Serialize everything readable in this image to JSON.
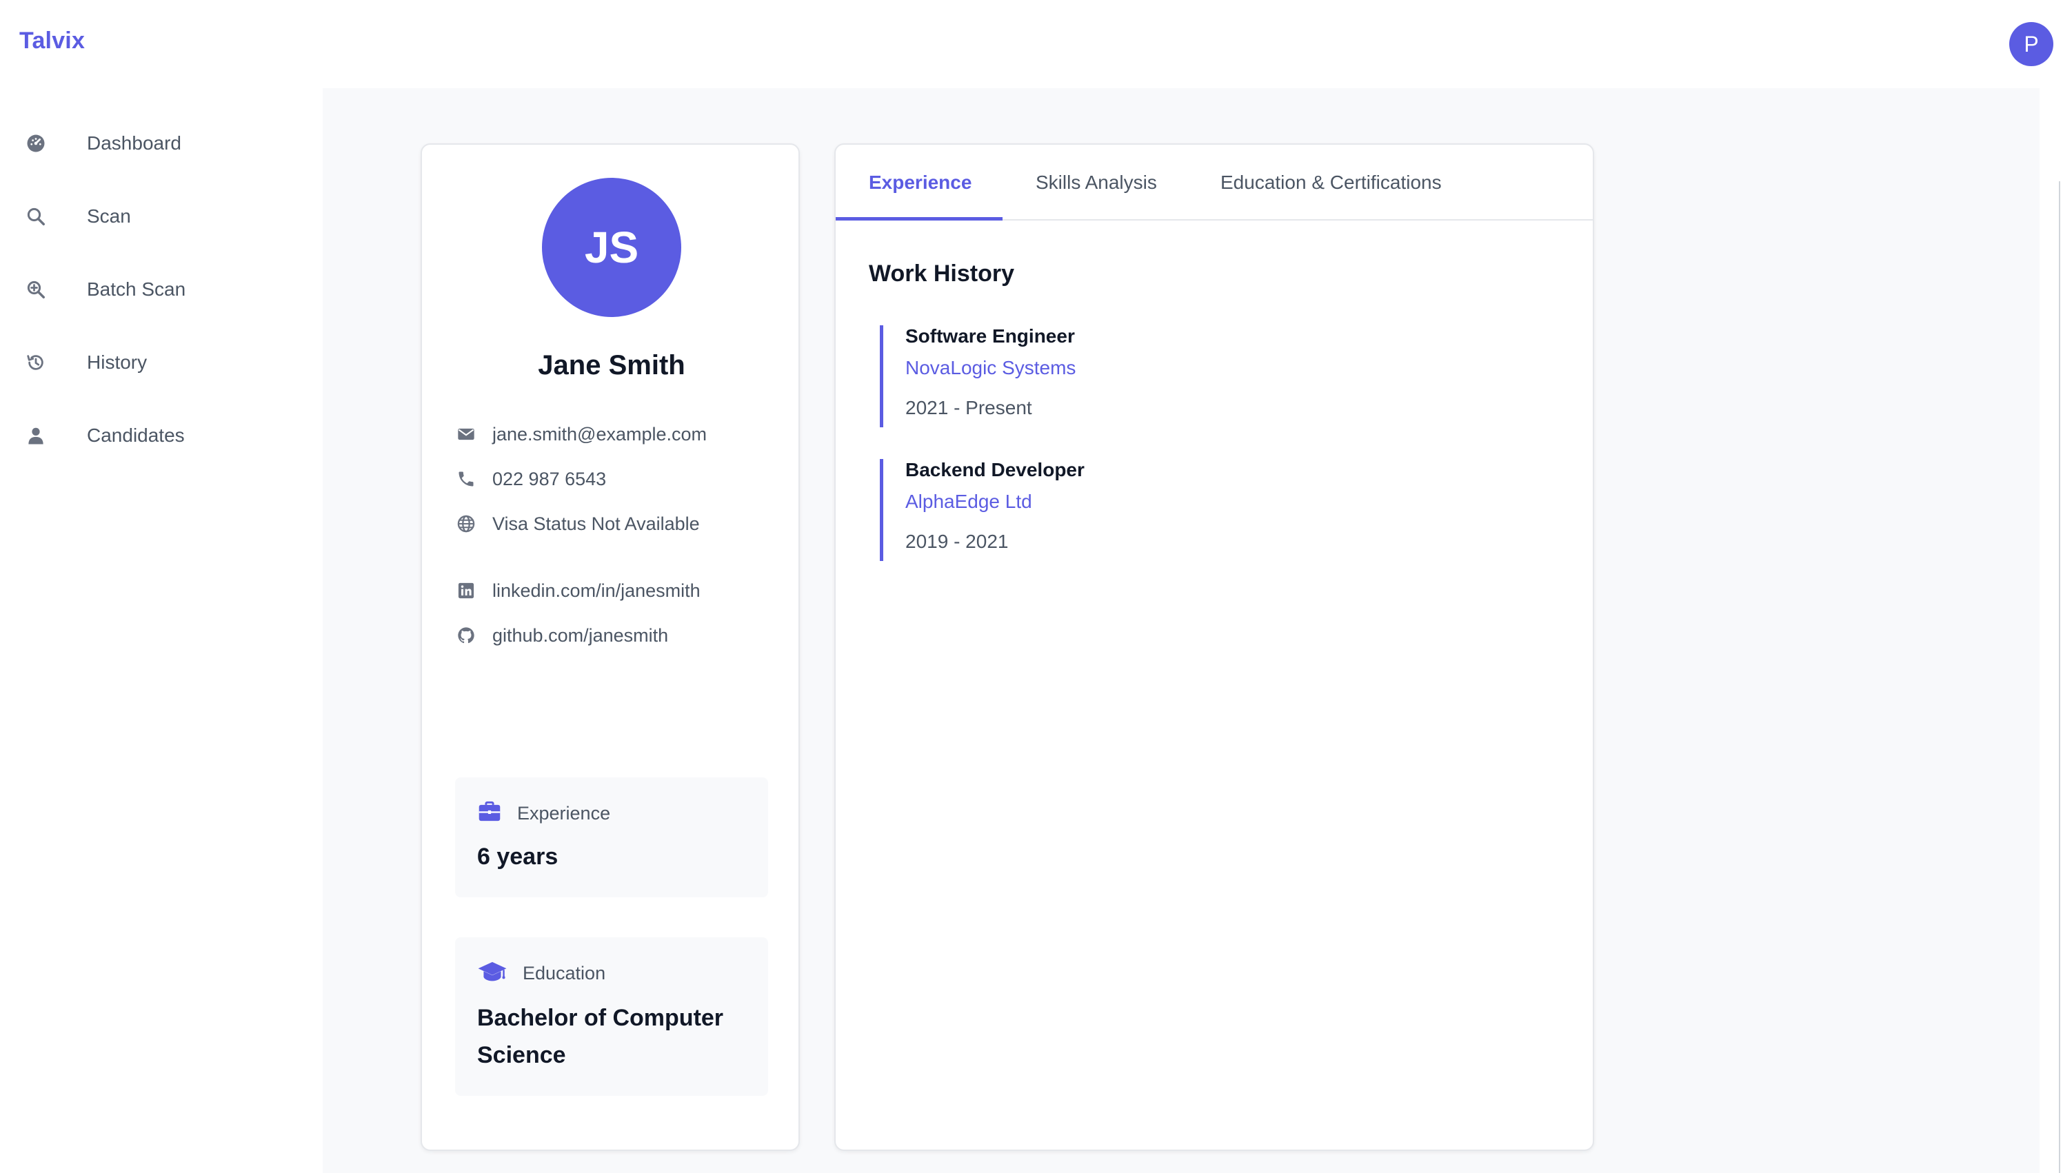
{
  "app": {
    "brand": "Talvix",
    "user_initial": "P"
  },
  "sidebar": {
    "items": [
      {
        "label": "Dashboard",
        "icon": "dashboard-icon"
      },
      {
        "label": "Scan",
        "icon": "search-icon"
      },
      {
        "label": "Batch Scan",
        "icon": "zoom-in-icon"
      },
      {
        "label": "History",
        "icon": "history-icon"
      },
      {
        "label": "Candidates",
        "icon": "person-icon"
      }
    ]
  },
  "profile": {
    "initials": "JS",
    "name": "Jane Smith",
    "email": "jane.smith@example.com",
    "phone": "022 987 6543",
    "visa": "Visa Status Not Available",
    "linkedin": "linkedin.com/in/janesmith",
    "github": "github.com/janesmith",
    "experience_label": "Experience",
    "experience_value": "6 years",
    "education_label": "Education",
    "education_value_line1": "Bachelor of Computer",
    "education_value_line2": "Science"
  },
  "tabs": [
    {
      "label": "Experience",
      "active": true
    },
    {
      "label": "Skills Analysis",
      "active": false
    },
    {
      "label": "Education & Certifications",
      "active": false
    }
  ],
  "work_history": {
    "title": "Work History",
    "jobs": [
      {
        "role": "Software Engineer",
        "company": "NovaLogic Systems",
        "dates": "2021 - Present"
      },
      {
        "role": "Backend Developer",
        "company": "AlphaEdge Ltd",
        "dates": "2019 - 2021"
      }
    ]
  },
  "colors": {
    "accent": "#5b5ce2",
    "text_primary": "#111827",
    "text_secondary": "#4b5563",
    "content_bg": "#f8f9fb"
  }
}
